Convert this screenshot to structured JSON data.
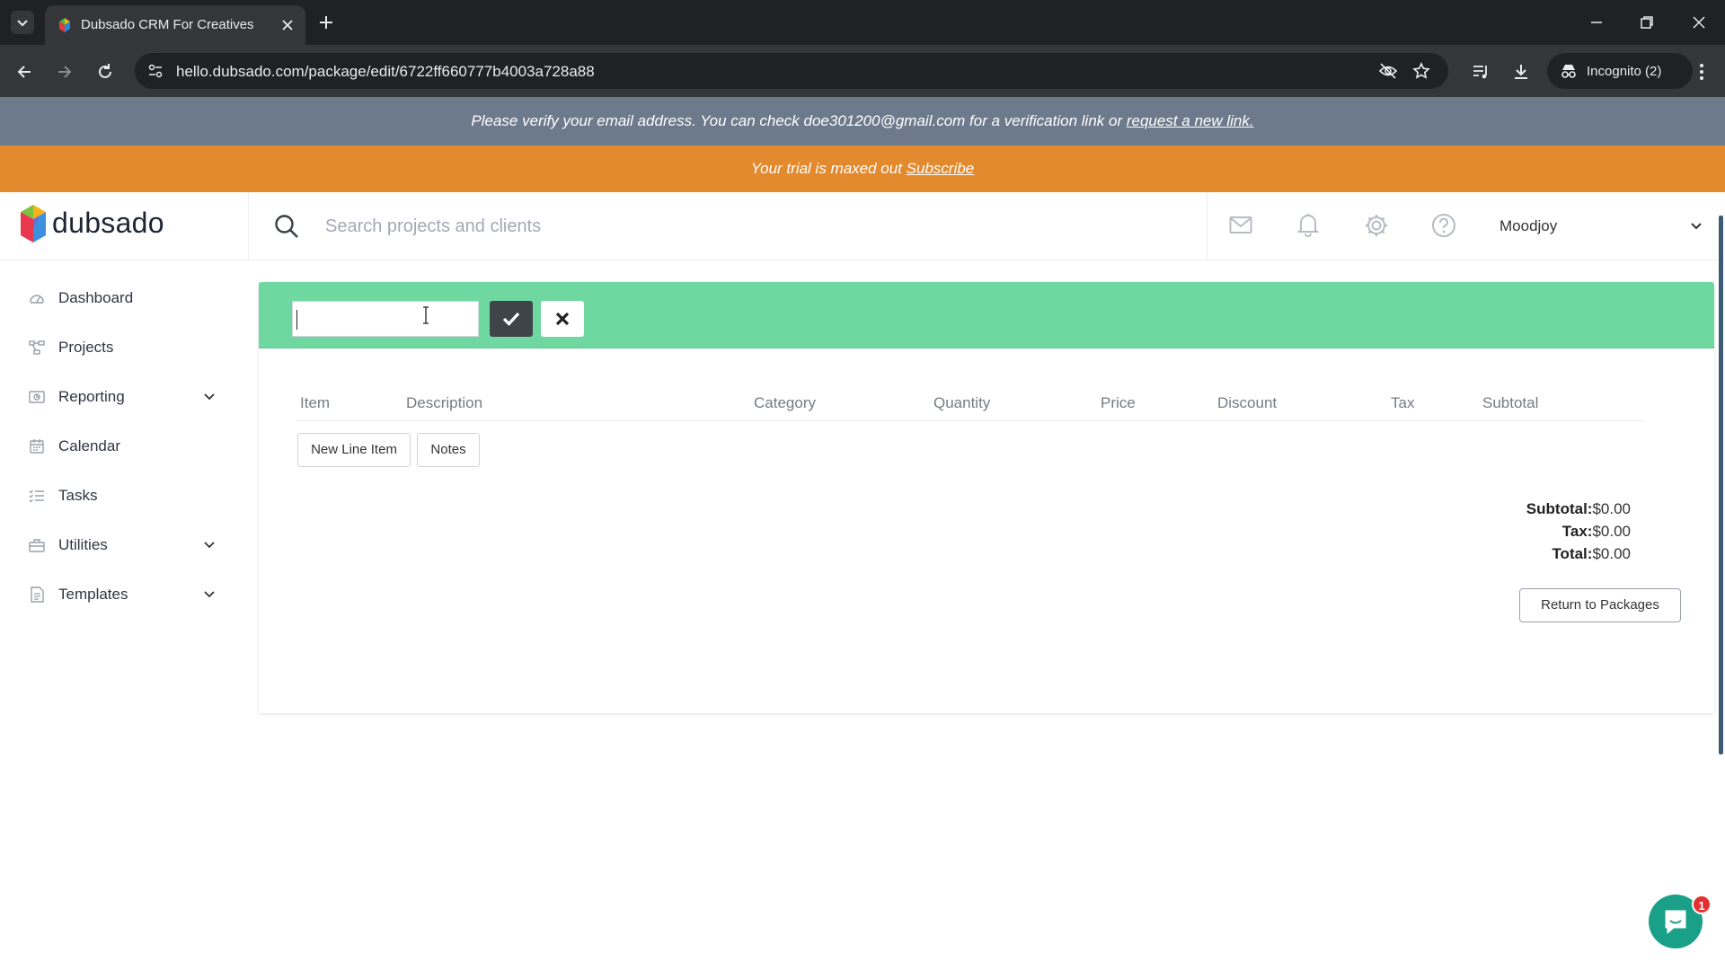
{
  "browser": {
    "tab_title": "Dubsado CRM For Creatives",
    "url": "hello.dubsado.com/package/edit/6722ff660777b4003a728a88",
    "incognito_label": "Incognito (2)"
  },
  "banners": {
    "verify_text": "Please verify your email address. You can check doe301200@gmail.com for a verification link or ",
    "verify_link": "request a new link.",
    "trial_text": "Your trial is maxed out ",
    "trial_link": "Subscribe"
  },
  "header": {
    "logo_text": "dubsado",
    "search_placeholder": "Search projects and clients",
    "user_name": "Moodjoy"
  },
  "sidebar": {
    "items": [
      {
        "label": "Dashboard",
        "icon": "dashboard-icon",
        "has_chevron": false
      },
      {
        "label": "Projects",
        "icon": "projects-icon",
        "has_chevron": false
      },
      {
        "label": "Reporting",
        "icon": "reporting-icon",
        "has_chevron": true
      },
      {
        "label": "Calendar",
        "icon": "calendar-icon",
        "has_chevron": false
      },
      {
        "label": "Tasks",
        "icon": "tasks-icon",
        "has_chevron": false
      },
      {
        "label": "Utilities",
        "icon": "utilities-icon",
        "has_chevron": true
      },
      {
        "label": "Templates",
        "icon": "templates-icon",
        "has_chevron": true
      }
    ]
  },
  "package_editor": {
    "name_value": "",
    "columns": [
      "Item",
      "Description",
      "Category",
      "Quantity",
      "Price",
      "Discount",
      "Tax",
      "Subtotal"
    ],
    "new_line_item_label": "New Line Item",
    "notes_label": "Notes",
    "totals": {
      "subtotal_label": "Subtotal:",
      "subtotal_value": "$0.00",
      "tax_label": "Tax:",
      "tax_value": "$0.00",
      "total_label": "Total:",
      "total_value": "$0.00"
    },
    "return_label": "Return to Packages"
  },
  "chat": {
    "badge_count": "1"
  },
  "colors": {
    "accent_green": "#6fd8a0",
    "trial_orange": "#e38a2e",
    "verify_gray": "#6d7a8b",
    "chat_teal": "#1aa088"
  }
}
